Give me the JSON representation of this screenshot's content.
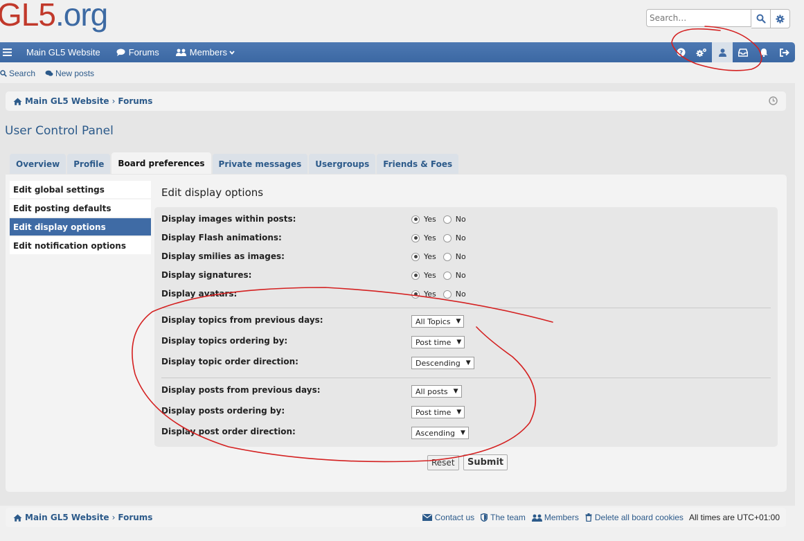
{
  "header": {
    "logo_part1": "GL5",
    "logo_part2": ".org",
    "search_placeholder": "Search…"
  },
  "navbar": {
    "main_site": "Main GL5 Website",
    "forums": "Forums",
    "members": "Members"
  },
  "subnav": {
    "search": "Search",
    "new_posts": "New posts"
  },
  "breadcrumb": {
    "home": "Main GL5 Website",
    "sep": "›",
    "forums": "Forums"
  },
  "page_title": "User Control Panel",
  "tabs": [
    {
      "label": "Overview"
    },
    {
      "label": "Profile"
    },
    {
      "label": "Board preferences",
      "active": true
    },
    {
      "label": "Private messages"
    },
    {
      "label": "Usergroups"
    },
    {
      "label": "Friends & Foes"
    }
  ],
  "sidemenu": [
    {
      "label": "Edit global settings"
    },
    {
      "label": "Edit posting defaults"
    },
    {
      "label": "Edit display options",
      "active": true
    },
    {
      "label": "Edit notification options"
    }
  ],
  "section_title": "Edit display options",
  "radio_rows": [
    {
      "label": "Display images within posts:",
      "yes": "Yes",
      "no": "No",
      "value": "yes"
    },
    {
      "label": "Display Flash animations:",
      "yes": "Yes",
      "no": "No",
      "value": "yes"
    },
    {
      "label": "Display smilies as images:",
      "yes": "Yes",
      "no": "No",
      "value": "yes"
    },
    {
      "label": "Display signatures:",
      "yes": "Yes",
      "no": "No",
      "value": "yes"
    },
    {
      "label": "Display avatars:",
      "yes": "Yes",
      "no": "No",
      "value": "yes"
    }
  ],
  "topic_rows": [
    {
      "label": "Display topics from previous days:",
      "value": "All Topics"
    },
    {
      "label": "Display topics ordering by:",
      "value": "Post time"
    },
    {
      "label": "Display topic order direction:",
      "value": "Descending"
    }
  ],
  "post_rows": [
    {
      "label": "Display posts from previous days:",
      "value": "All posts"
    },
    {
      "label": "Display posts ordering by:",
      "value": "Post time"
    },
    {
      "label": "Display post order direction:",
      "value": "Ascending"
    }
  ],
  "buttons": {
    "reset": "Reset",
    "submit": "Submit"
  },
  "footer": {
    "contact": "Contact us",
    "team": "The team",
    "members": "Members",
    "delete_cookies": "Delete all board cookies",
    "timezone": "All times are UTC+01:00"
  },
  "colors": {
    "navbar": "#3f6ba5",
    "link": "#2c5a8a",
    "annotation": "#d42020"
  }
}
